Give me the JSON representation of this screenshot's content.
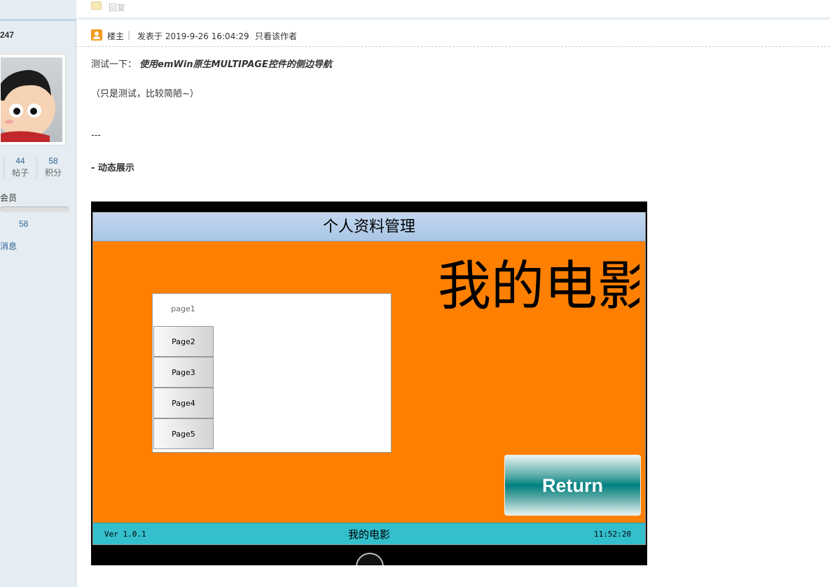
{
  "sidebar": {
    "username": "247",
    "stats": [
      {
        "value": "44",
        "label": "帖子"
      },
      {
        "value": "58",
        "label": "积分"
      }
    ],
    "group": "会员",
    "credits": "58",
    "message_link": "消息"
  },
  "reply": {
    "label": "回复"
  },
  "post": {
    "host_label": "楼主",
    "posted_at": "发表于 2019-9-26 16:04:29",
    "only_author": "只看该作者",
    "intro_prefix": "测试一下：",
    "intro_title": "使用emWin原生MULTIPAGE控件的侧边导航",
    "note": "（只是测试，比较简陋~）",
    "divider": "---",
    "section": "- 动态展示"
  },
  "screenshot": {
    "title": "个人资料管理",
    "tabs": [
      "page1",
      "Page2",
      "Page3",
      "Page4",
      "Page5"
    ],
    "big_title": "我的电影",
    "return_label": "Return",
    "version": "Ver 1.0.1",
    "status_title": "我的电影",
    "clock": "11:52:20"
  },
  "colors": {
    "sidebar_bg": "#e5edf2",
    "link": "#336699",
    "screen_bg": "#ff8000",
    "status_bar": "#33bfcc",
    "title_bar": "#a9c5e6",
    "return_button": "#008080"
  }
}
